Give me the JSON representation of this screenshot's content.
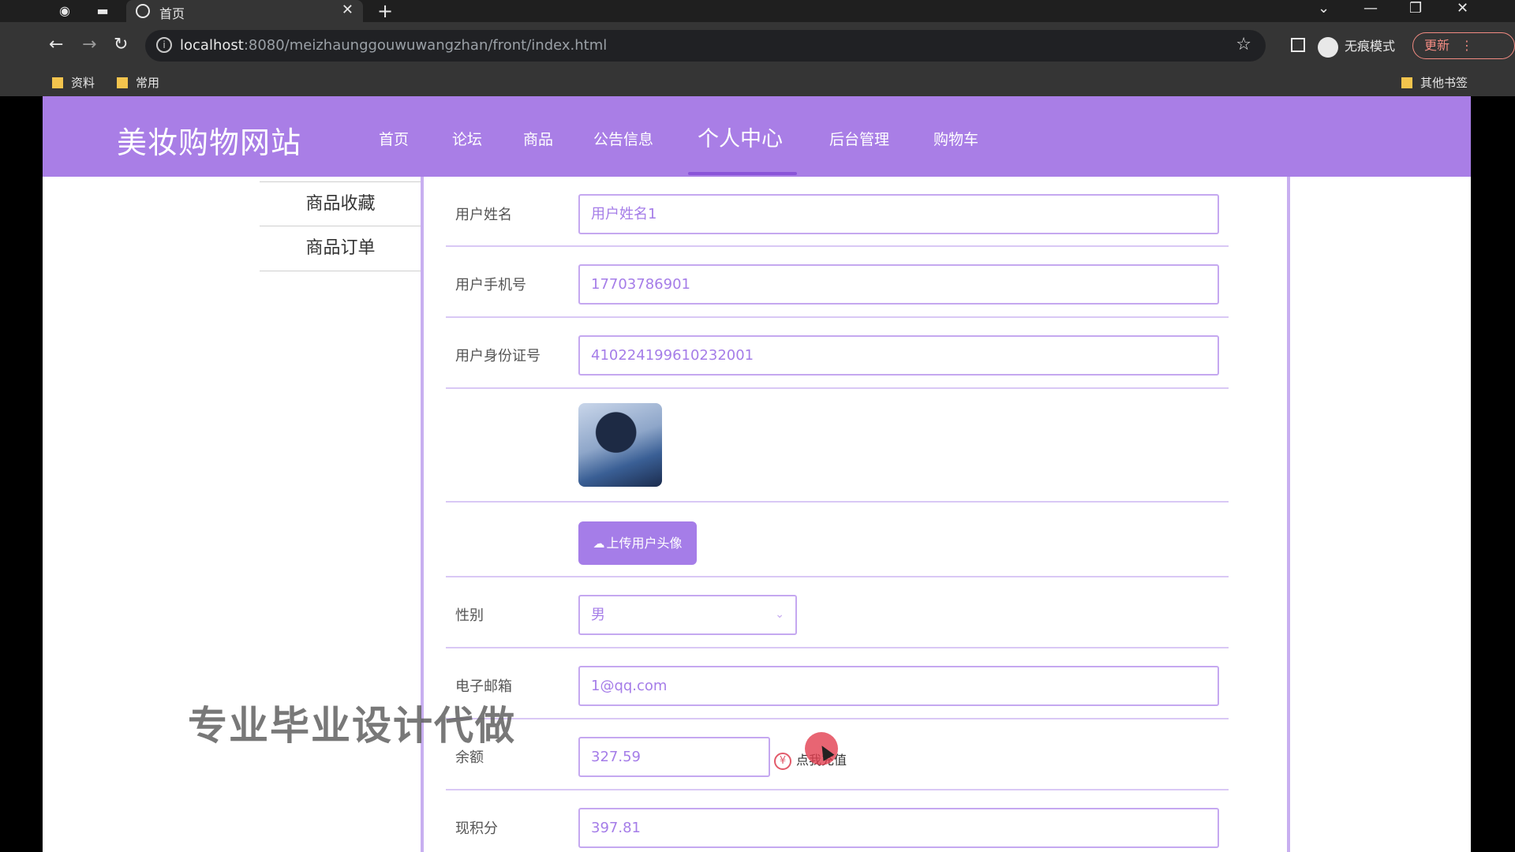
{
  "browser": {
    "tab_title": "首页",
    "tab_close": "✕",
    "new_tab": "+",
    "url_host": "localhost",
    "url_rest": ":8080/meizhaunggouwuwangzhan/front/index.html",
    "incognito_label": "无痕模式",
    "update_label": "更新",
    "bookmarks": [
      "资料",
      "常用"
    ],
    "other_bookmarks": "其他书签"
  },
  "site": {
    "title": "美妆购物网站",
    "nav": [
      {
        "label": "首页",
        "active": false
      },
      {
        "label": "论坛",
        "active": false
      },
      {
        "label": "商品",
        "active": false
      },
      {
        "label": "公告信息",
        "active": false
      },
      {
        "label": "个人中心",
        "active": true
      },
      {
        "label": "后台管理",
        "active": false
      },
      {
        "label": "购物车",
        "active": false
      }
    ]
  },
  "sidebar": {
    "items": [
      {
        "label": "商品收藏"
      },
      {
        "label": "商品订单"
      }
    ]
  },
  "form": {
    "username_label": "用户姓名",
    "username_value": "用户姓名1",
    "phone_label": "用户手机号",
    "phone_value": "17703786901",
    "idcard_label": "用户身份证号",
    "idcard_value": "410224199610232001",
    "upload_label": "上传用户头像",
    "gender_label": "性别",
    "gender_value": "男",
    "email_label": "电子邮箱",
    "email_value": "1@qq.com",
    "balance_label": "余额",
    "balance_value": "327.59",
    "recharge_symbol": "¥",
    "recharge_label": "点我充值",
    "points_label": "现积分",
    "points_value": "397.81"
  },
  "overlay": {
    "watermark": "专业毕业设计代做"
  },
  "colors": {
    "header": "#a97ee6",
    "accent": "#a57de8",
    "input_border": "#c5a8f0"
  }
}
